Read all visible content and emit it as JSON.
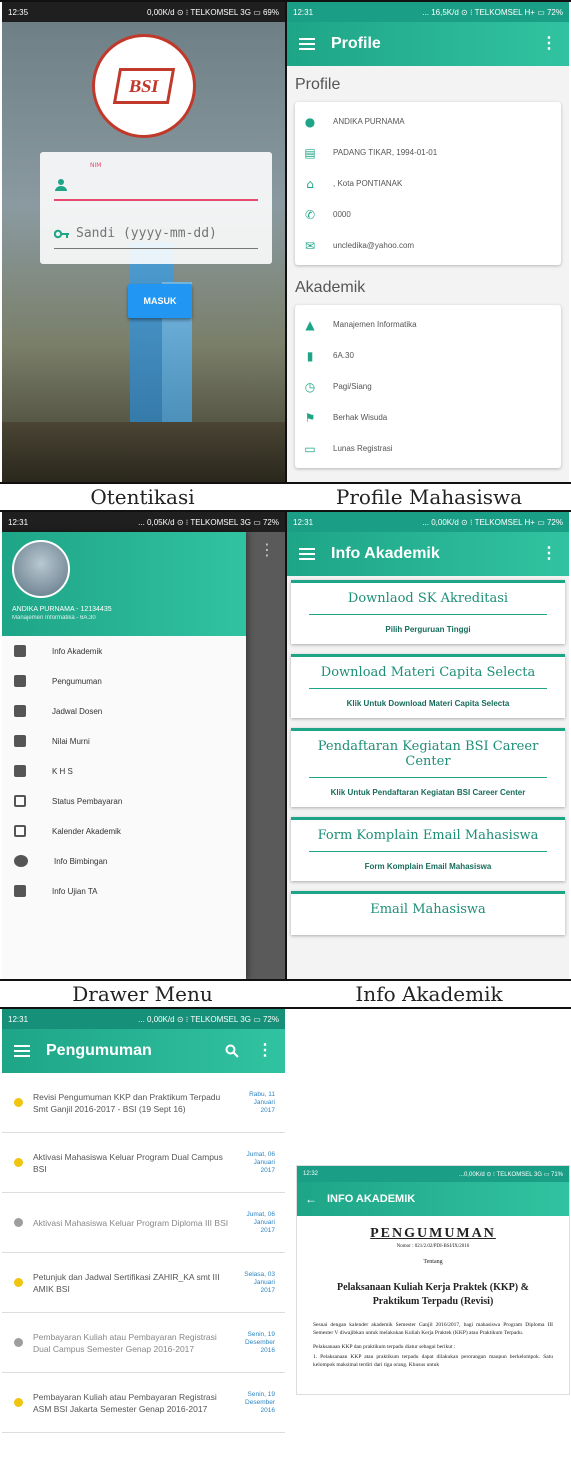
{
  "captions": {
    "otentikasi": "Otentikasi",
    "profile": "Profile Mahasiswa",
    "drawer": "Drawer Menu",
    "info": "Info Akademik"
  },
  "login": {
    "status_time": "12:35",
    "status_info": "0,00K/d ⊙ ⁝ TELKOMSEL 3G ▭ 69%",
    "logo_text": "BSI",
    "nim_label": "NIM",
    "password_placeholder": "Sandi (yyyy-mm-dd)",
    "masuk_label": "MASUK"
  },
  "profile": {
    "status_time": "12:31",
    "status_info": "... 16,5K/d ⊙ ⁝ TELKOMSEL H+ ▭ 72%",
    "appbar_title": "Profile",
    "section_profile": "Profile",
    "items": [
      {
        "icon": "person-icon",
        "text": "ANDIKA PURNAMA"
      },
      {
        "icon": "id-card-icon",
        "text": "PADANG TIKAR, 1994-01-01"
      },
      {
        "icon": "home-icon",
        "text": ", Kota PONTIANAK"
      },
      {
        "icon": "phone-icon",
        "text": "0000"
      },
      {
        "icon": "email-icon",
        "text": "uncledika@yahoo.com"
      }
    ],
    "section_akademik": "Akademik",
    "akademik": [
      {
        "icon": "school-icon",
        "text": "Manajemen Informatika"
      },
      {
        "icon": "bookmark-icon",
        "text": "6A.30"
      },
      {
        "icon": "clock-icon",
        "text": "Pagi/Siang"
      },
      {
        "icon": "flag-icon",
        "text": "Berhak Wisuda"
      },
      {
        "icon": "credit-card-icon",
        "text": "Lunas Registrasi"
      }
    ]
  },
  "drawer": {
    "status_time": "12:31",
    "status_info": "... 0,05K/d ⊙ ⁝ TELKOMSEL 3G ▭ 72%",
    "user_name": "ANDIKA PURNAMA - 12134435",
    "user_sub": "Manajemen Informatika - 6A.30",
    "items": [
      "Info Akademik",
      "Pengumuman",
      "Jadwal Dosen",
      "Nilai Murni",
      "K H S",
      "Status Pembayaran",
      "Kalender Akademik",
      "Info Bimbingan",
      "Info Ujian TA"
    ]
  },
  "info": {
    "status_time": "12:31",
    "status_info": "... 0,00K/d ⊙ ⁝ TELKOMSEL H+ ▭ 72%",
    "appbar_title": "Info Akademik",
    "cards": [
      {
        "title": "Downlaod SK Akreditasi",
        "link": "Pilih Perguruan Tinggi"
      },
      {
        "title": "Download Materi Capita Selecta",
        "link": "Klik Untuk Download Materi Capita Selecta"
      },
      {
        "title": "Pendaftaran Kegiatan BSI Career Center",
        "link": "Klik Untuk Pendaftaran Kegiatan BSI Career Center"
      },
      {
        "title": "Form Komplain Email Mahasiswa",
        "link": "Form Komplain Email Mahasiswa"
      },
      {
        "title": "Email Mahasiswa",
        "link": ""
      }
    ]
  },
  "pengumuman": {
    "status_time": "12:31",
    "status_info": "... 0,00K/d ⊙ ⁝ TELKOMSEL 3G ▭ 72%",
    "appbar_title": "Pengumuman",
    "items": [
      {
        "title": "Revisi Pengumuman KKP dan Praktikum Terpadu Smt Ganjil 2016-2017 - BSI (19 Sept 16)",
        "day": "Rabu, 11",
        "month": "Januari",
        "year": "2017",
        "dot": "#f1c40f"
      },
      {
        "title": "Aktivasi Mahasiswa Keluar Program Dual Campus BSI",
        "day": "Jumat, 06",
        "month": "Januari",
        "year": "2017",
        "dot": "#f1c40f"
      },
      {
        "title": "Aktivasi Mahasiswa Keluar Program Diploma III BSI",
        "day": "Jumat, 06",
        "month": "Januari",
        "year": "2017",
        "dot": "#9e9e9e"
      },
      {
        "title": "Petunjuk dan Jadwal Sertifikasi ZAHIR_KA smt III AMIK BSI",
        "day": "Selasa, 03",
        "month": "Januari",
        "year": "2017",
        "dot": "#f1c40f"
      },
      {
        "title": "Pembayaran Kuliah atau Pembayaran Registrasi Dual Campus Semester Genap 2016-2017",
        "day": "Senin, 19",
        "month": "Desember",
        "year": "2016",
        "dot": "#9e9e9e"
      },
      {
        "title": "Pembayaran Kuliah atau Pembayaran Registrasi ASM BSI Jakarta Semester Genap 2016-2017",
        "day": "Senin, 19",
        "month": "Desember",
        "year": "2016",
        "dot": "#f1c40f"
      }
    ]
  },
  "document": {
    "status_time": "12:32",
    "status_info": "...0,00K/d ⊙ ⁝ TELKOMSEL 3G ▭ 71%",
    "appbar_title": "INFO AKADEMIK",
    "heading": "PENGUMUMAN",
    "nomor": "Nomor : 021/2.02/PDI-BSI/IX/2016",
    "tentang": "Tentang",
    "subject": "Pelaksanaan Kuliah Kerja Praktek (KKP) & Praktikum Terpadu (Revisi)",
    "para1": "Sesuai dengan kalender akademik Semester Ganjil 2016/2017, bagi mahasiswa Program Diploma III Semester V diwajibkan untuk melakukan Kuliah Kerja Praktek (KKP) atau Praktikum Terpadu.",
    "para2": "Pelaksanaan KKP dan praktikum terpadu diatur sebagai berikut :",
    "para3": "1. Pelaksanaan KKP atau praktikum terpadu dapat dilakukan perorangan maupun berkelompok. Satu kelompok maksimal terdiri dari tiga orang. Khusus untuk"
  }
}
